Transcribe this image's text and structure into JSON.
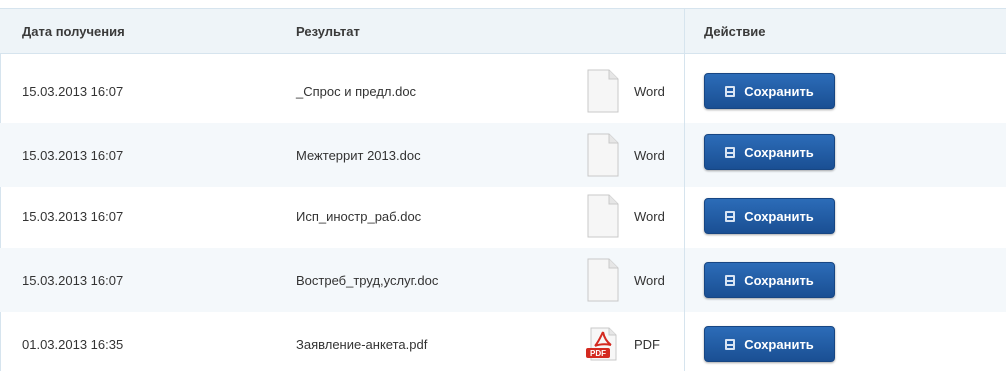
{
  "header": {
    "col_date": "Дата получения",
    "col_result": "Результат",
    "col_action": "Действие"
  },
  "rows": [
    {
      "date": "15.03.2013 16:07",
      "file": "_Спрос и предл.doc",
      "type": "Word",
      "icon": "word-document-icon",
      "action": "Сохранить"
    },
    {
      "date": "15.03.2013 16:07",
      "file": "Межтеррит 2013.doc",
      "type": "Word",
      "icon": "word-document-icon",
      "action": "Сохранить"
    },
    {
      "date": "15.03.2013 16:07",
      "file": "Исп_иностр_раб.doc",
      "type": "Word",
      "icon": "word-document-icon",
      "action": "Сохранить"
    },
    {
      "date": "15.03.2013 16:07",
      "file": "Востреб_труд,услуг.doc",
      "type": "Word",
      "icon": "word-document-icon",
      "action": "Сохранить"
    },
    {
      "date": "01.03.2013 16:35",
      "file": "Заявление-анкета.pdf",
      "type": "PDF",
      "icon": "pdf-document-icon",
      "action": "Сохранить"
    }
  ],
  "colors": {
    "header_bg": "#eef4f8",
    "button": "#1f5aa3",
    "pdf_red": "#d42a20"
  }
}
